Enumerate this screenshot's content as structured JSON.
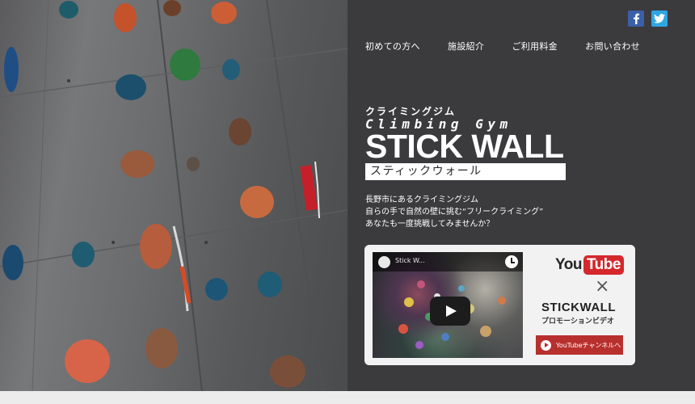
{
  "social": {
    "facebook_label": "f",
    "facebook_icon": "facebook-icon",
    "twitter_icon": "twitter-icon",
    "facebook_color": "#3b5fa8",
    "twitter_color": "#2ea6e4"
  },
  "nav": {
    "items": [
      {
        "label": "初めての方へ"
      },
      {
        "label": "施設紹介"
      },
      {
        "label": "ご利用料金"
      },
      {
        "label": "お問い合わせ"
      }
    ]
  },
  "logo": {
    "kana": "クライミングジム",
    "english": "Climbing Gym",
    "name": "STICK WALL",
    "name_kana": "スティックウォール"
  },
  "intro": {
    "line1": "長野市にあるクライミングジム",
    "line2": "自らの手で自然の壁に挑む“フリークライミング”",
    "line3": "あなたも一度挑戦してみませんか？"
  },
  "video": {
    "title": "Stick W...",
    "play_icon": "play-icon",
    "youtube_you": "You",
    "youtube_tube": "Tube",
    "times": "×",
    "brand": "STICKWALL",
    "brand_sub": "プロモーションビデオ",
    "channel_button": "YouTubeチャンネルへ",
    "accent_color": "#b8302e"
  },
  "colors": {
    "panel_bg": "#3b3b3d",
    "page_bg": "#ececec"
  }
}
